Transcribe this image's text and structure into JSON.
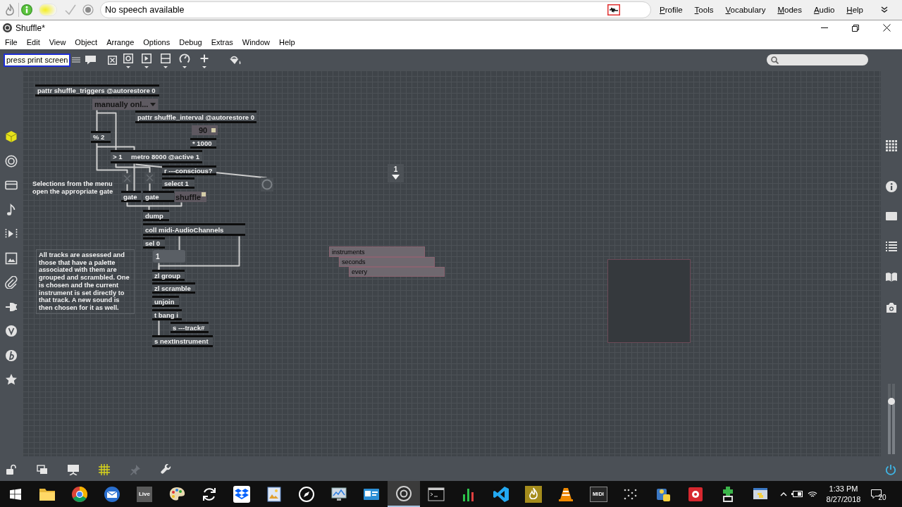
{
  "speech_bar": {
    "status": "No speech available",
    "menu": [
      "Profile",
      "Tools",
      "Vocabulary",
      "Modes",
      "Audio",
      "Help"
    ]
  },
  "window": {
    "title": "Shuffle*"
  },
  "menu_bar": [
    "File",
    "Edit",
    "View",
    "Object",
    "Arrange",
    "Options",
    "Debug",
    "Extras",
    "Window",
    "Help"
  ],
  "toolbar": {
    "tooltip": "press print screen"
  },
  "patcher": {
    "objects": [
      {
        "kind": "object",
        "text": "pattr shuffle_triggers @autorestore 0"
      },
      {
        "kind": "menu",
        "text": "manually onl..."
      },
      {
        "kind": "object",
        "text": "pattr shuffle_interval @autorestore 0"
      },
      {
        "kind": "number",
        "text": "90"
      },
      {
        "kind": "object",
        "text": "% 2"
      },
      {
        "kind": "object",
        "text": "* 1000"
      },
      {
        "kind": "object",
        "text": "> 1"
      },
      {
        "kind": "object",
        "text": "metro 8000 @active 1"
      },
      {
        "kind": "dropdown",
        "text": "1"
      },
      {
        "kind": "object",
        "text": "r ---conscious?"
      },
      {
        "kind": "toggle",
        "on": false
      },
      {
        "kind": "toggle",
        "on": false
      },
      {
        "kind": "object",
        "text": "select 1"
      },
      {
        "kind": "bang"
      },
      {
        "kind": "comment",
        "text": "Selections from the menu open the appropriate gate",
        "framed": false
      },
      {
        "kind": "object",
        "text": "gate"
      },
      {
        "kind": "object",
        "text": "gate"
      },
      {
        "kind": "textbutton",
        "text": "shuffle"
      },
      {
        "kind": "object",
        "text": "dump"
      },
      {
        "kind": "object",
        "text": "coll midi-AudioChannels"
      },
      {
        "kind": "object",
        "text": "sel 0"
      },
      {
        "kind": "label",
        "text": "instruments"
      },
      {
        "kind": "message",
        "text": "1"
      },
      {
        "kind": "comment",
        "text": "All tracks are assessed and those that have a palette associated with them are grouped and scrambled. One is chosen and the current instrument is set directly to that track. A new sound is then chosen for it as well.",
        "framed": true
      },
      {
        "kind": "label",
        "text": "seconds"
      },
      {
        "kind": "panel"
      },
      {
        "kind": "label",
        "text": "every"
      },
      {
        "kind": "object",
        "text": "zl group"
      },
      {
        "kind": "object",
        "text": "zl scramble"
      },
      {
        "kind": "object",
        "text": "unjoin"
      },
      {
        "kind": "object",
        "text": "t bang i"
      },
      {
        "kind": "object",
        "text": "s ---track#"
      },
      {
        "kind": "object",
        "text": "s nextInstrument"
      }
    ]
  },
  "right_sidebar": {
    "volume": {
      "level": 0.75
    }
  },
  "footer": {
    "tools": [
      {
        "on": false,
        "disabled": false
      },
      {
        "on": false,
        "disabled": false
      },
      {
        "on": false,
        "disabled": false
      },
      {
        "on": true,
        "disabled": false
      },
      {
        "on": false,
        "disabled": true
      },
      {
        "on": false,
        "disabled": false
      }
    ],
    "audio": {
      "on": true
    }
  },
  "taskbar": {
    "apps": [
      {
        "kind": "icon",
        "selected": false
      },
      {
        "kind": "icon",
        "selected": false
      },
      {
        "kind": "icon",
        "selected": false
      },
      {
        "kind": "tile",
        "label": "Live",
        "selected": false
      },
      {
        "kind": "icon",
        "selected": false
      },
      {
        "kind": "icon",
        "selected": false
      },
      {
        "kind": "icon",
        "selected": false
      },
      {
        "kind": "icon",
        "selected": false
      },
      {
        "kind": "icon",
        "selected": false
      },
      {
        "kind": "icon",
        "selected": false
      },
      {
        "kind": "icon",
        "selected": false
      },
      {
        "kind": "icon",
        "selected": true
      },
      {
        "kind": "icon",
        "selected": false
      },
      {
        "kind": "icon",
        "selected": false
      },
      {
        "kind": "icon",
        "selected": false
      },
      {
        "kind": "icon",
        "selected": false
      },
      {
        "kind": "icon",
        "selected": false
      },
      {
        "kind": "tile",
        "label": "MIDI",
        "selected": false
      },
      {
        "kind": "icon",
        "selected": false
      },
      {
        "kind": "icon",
        "selected": false
      },
      {
        "kind": "icon",
        "selected": false
      },
      {
        "kind": "icon",
        "selected": false
      },
      {
        "kind": "icon",
        "selected": false
      }
    ],
    "clock": {
      "time": "1:33 PM",
      "date": "8/27/2018"
    },
    "notifications": "20"
  }
}
